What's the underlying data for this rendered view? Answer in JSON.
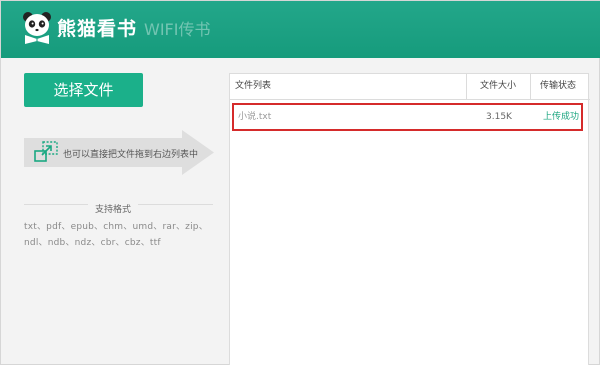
{
  "header": {
    "brand": "熊猫看书",
    "subtitle": "WIFI传书",
    "logo_icon": "panda-book-logo-icon"
  },
  "left": {
    "choose_button": "选择文件",
    "drag_hint": "也可以直接把文件拖到右边列表中",
    "drag_icon": "drag-resize-icon",
    "formats_title": "支持格式",
    "formats": "txt、pdf、epub、chm、umd、rar、zip、ndl、ndb、ndz、cbr、cbz、ttf"
  },
  "table": {
    "columns": [
      "文件列表",
      "文件大小",
      "传输状态"
    ],
    "rows": [
      {
        "name": "小说.txt",
        "size": "3.15K",
        "status": "上传成功"
      }
    ]
  },
  "colors": {
    "brand_green": "#1aa882",
    "highlight_red": "#d52b2b",
    "status_green": "#1aa57f"
  }
}
